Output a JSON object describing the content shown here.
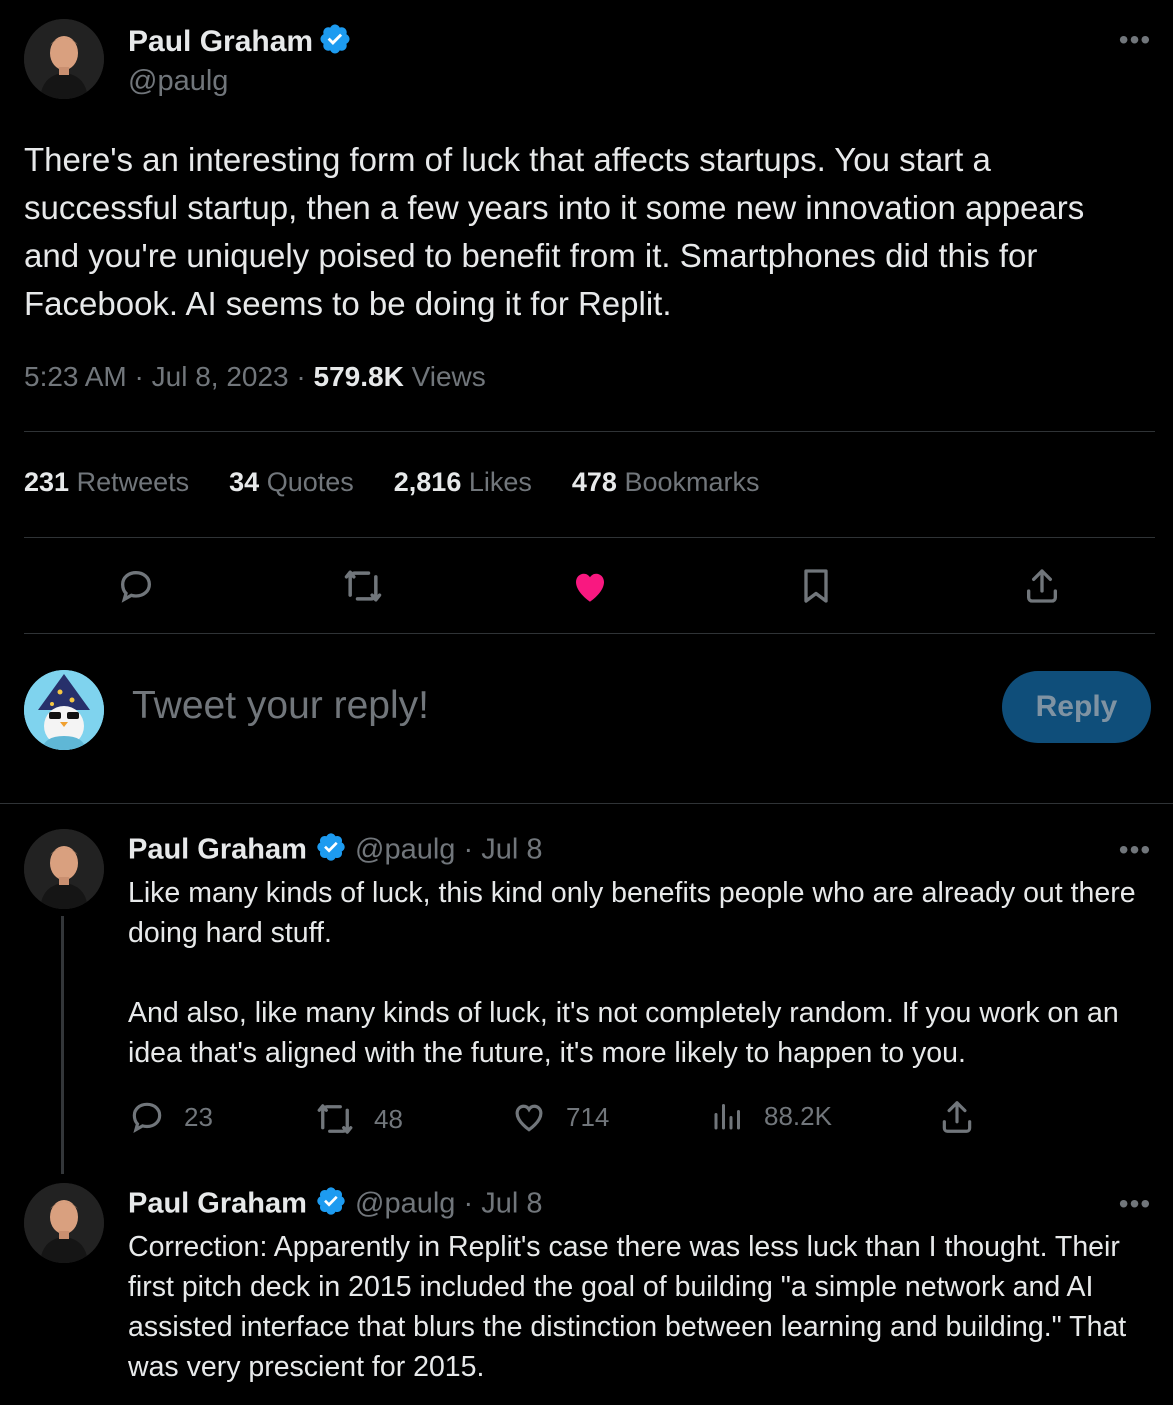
{
  "main_tweet": {
    "author": {
      "name": "Paul Graham",
      "handle": "@paulg"
    },
    "more_icon": "ellipsis-icon",
    "text": "There's an interesting form of luck that affects startups. You start a successful startup, then a few years into it some new innovation appears and you're uniquely poised to benefit from it. Smartphones did this for Facebook. AI seems to be doing it for Replit.",
    "time": "5:23 AM",
    "separator": "·",
    "date": "Jul 8, 2023",
    "views_count": "579.8K",
    "views_label": "Views",
    "stats": {
      "retweets_count": "231",
      "retweets_label": "Retweets",
      "quotes_count": "34",
      "quotes_label": "Quotes",
      "likes_count": "2,816",
      "likes_label": "Likes",
      "bookmarks_count": "478",
      "bookmarks_label": "Bookmarks"
    },
    "actions": [
      "reply-icon",
      "retweet-icon",
      "heart-filled-icon",
      "bookmark-icon",
      "share-icon"
    ]
  },
  "reply_composer": {
    "placeholder": "Tweet your reply!",
    "button_label": "Reply"
  },
  "replies": [
    {
      "name": "Paul Graham",
      "handle": "@paulg",
      "date_sep": "·",
      "date": "Jul 8",
      "paragraph_1": "Like many kinds of luck, this kind only benefits people who are already out there doing hard stuff.",
      "paragraph_2": "And also, like many kinds of luck, it's not completely random. If you work on an idea that's aligned with the future, it's more likely to happen to you.",
      "reply_count": "23",
      "retweet_count": "48",
      "like_count": "714",
      "view_count": "88.2K"
    },
    {
      "name": "Paul Graham",
      "handle": "@paulg",
      "date_sep": "·",
      "date": "Jul 8",
      "text": "Correction: Apparently in Replit's case there was less luck than I thought. Their first pitch deck in 2015 included the goal of building \"a simple network and AI assisted interface that blurs the distinction between learning and building.\" That was very prescient for 2015."
    }
  ],
  "colors": {
    "background": "#000000",
    "text": "#e7e9ea",
    "muted": "#71767b",
    "divider": "#2f3336",
    "verified": "#1d9bf0",
    "like": "#f91880",
    "reply_button": "#0f4e7a"
  }
}
